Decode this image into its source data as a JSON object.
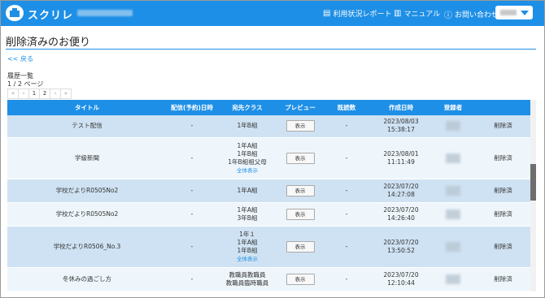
{
  "header": {
    "brand": "スクリレ",
    "nav": [
      {
        "label": "利用状況レポート",
        "icon": "report-icon"
      },
      {
        "label": "マニュアル",
        "icon": "book-icon"
      },
      {
        "label": "お問い合わせ",
        "icon": "question-icon"
      }
    ]
  },
  "page": {
    "title": "削除済みのお便り",
    "back_link": "<< 戻る",
    "history_label": "履歴一覧",
    "page_info": "1 / 2 ページ"
  },
  "pager": [
    "«",
    "‹",
    "1",
    "2",
    "›",
    "»"
  ],
  "table": {
    "columns": [
      "タイトル",
      "配信(予約)日時",
      "宛先クラス",
      "プレビュー",
      "既読数",
      "作成日時",
      "登録者",
      ""
    ],
    "rows": [
      {
        "title": "テスト配信",
        "delivery": "-",
        "classes": [
          "1年B組"
        ],
        "show_all": "",
        "preview": "表示",
        "read": "-",
        "date": "2023/08/03",
        "time": "15:38:17",
        "status": "削除済"
      },
      {
        "title": "学級新聞",
        "delivery": "-",
        "classes": [
          "1年A組",
          "1年B組",
          "1年B組祖父母"
        ],
        "show_all": "全体表示",
        "preview": "表示",
        "read": "-",
        "date": "2023/08/01",
        "time": "11:11:49",
        "status": "削除済"
      },
      {
        "title": "学校だよりR0505No2",
        "delivery": "-",
        "classes": [
          "1年A組"
        ],
        "show_all": "",
        "preview": "表示",
        "read": "-",
        "date": "2023/07/20",
        "time": "14:27:08",
        "status": "削除済"
      },
      {
        "title": "学校だよりR0505No2",
        "delivery": "-",
        "classes": [
          "1年A組",
          "3年B組"
        ],
        "show_all": "",
        "preview": "表示",
        "read": "-",
        "date": "2023/07/20",
        "time": "14:26:40",
        "status": "削除済"
      },
      {
        "title": "学校だよりR0506_No.3",
        "delivery": "-",
        "classes": [
          "1年１",
          "1年A組",
          "1年B組"
        ],
        "show_all": "全体表示",
        "preview": "表示",
        "read": "-",
        "date": "2023/07/20",
        "time": "13:50:52",
        "status": "削除済"
      },
      {
        "title": "冬休みの過ごし方",
        "delivery": "-",
        "classes": [
          "教職員教職員",
          "教職員臨時職員"
        ],
        "show_all": "",
        "preview": "表示",
        "read": "-",
        "date": "2023/07/20",
        "time": "12:10:44",
        "status": "削除済"
      }
    ]
  }
}
